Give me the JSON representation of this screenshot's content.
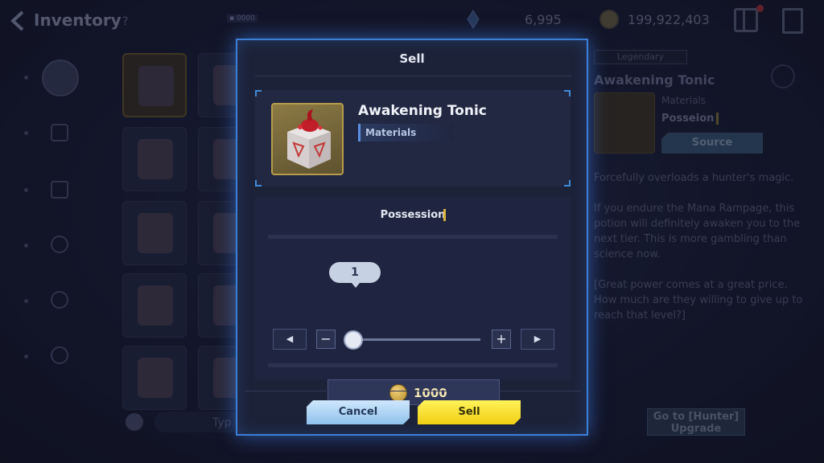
{
  "topbar": {
    "title": "Inventory",
    "help_glyph": "?",
    "progress_chip": "▪ 0000",
    "crystal_amount": "6,995",
    "gold_amount": "199,922,403"
  },
  "detail": {
    "rarity": "Legendary",
    "name": "Awakening Tonic",
    "category": "Materials",
    "possession_label": "Posseion",
    "source_button": "Source",
    "description": "Forcefully overloads a hunter's magic.\n\nIf you endure the Mana Rampage, this potion will definitely awaken you to the next tier. This is more gambling than science now.\n\n[Great power comes at a great price. How much are they willing to give up to reach that level?]",
    "goto_button": "Go to [Hunter] Upgrade",
    "filter_label": "Typ"
  },
  "sell_dialog": {
    "title": "Sell",
    "item_name": "Awakening Tonic",
    "item_category": "Materials",
    "possession_label": "Possession",
    "quantity": "1",
    "quantity_fraction": 0.0,
    "decrease_all_glyph": "◀",
    "decrease_glyph": "−",
    "increase_glyph": "+",
    "increase_all_glyph": "▶",
    "price": "1000",
    "cancel_label": "Cancel",
    "sell_label": "Sell"
  },
  "colors": {
    "modal_border": "#3c7fd6",
    "sell_button": "#f0cf14",
    "cancel_button": "#8fc2ee",
    "rarity_gold": "#b79b4c"
  }
}
